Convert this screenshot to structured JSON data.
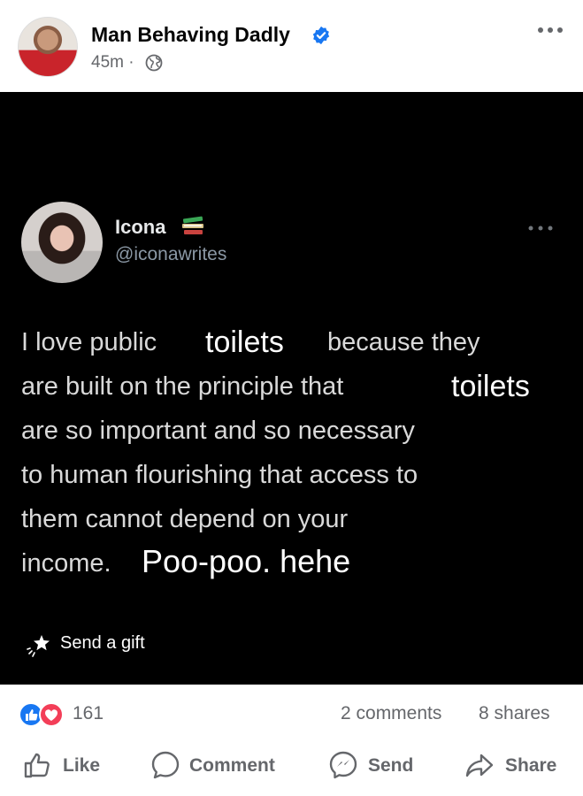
{
  "post": {
    "author": "Man Behaving Dadly",
    "time": "45m ·"
  },
  "tweet": {
    "name": "Icona",
    "handle": "@iconawrites",
    "lines": {
      "l1a": "I love public",
      "l1b": "because they",
      "l2": "are built on the principle that",
      "l3": "are so important and so necessary",
      "l4": "to human flourishing that access to",
      "l5": "them cannot depend on your",
      "l6": "income."
    },
    "overlays": {
      "o1": "toilets",
      "o2": "toilets",
      "o3": "Poo-poo. hehe"
    },
    "gift_label": "Send a gift"
  },
  "stats": {
    "reaction_count": "161",
    "comments": "2 comments",
    "shares": "8 shares"
  },
  "actions": {
    "like": "Like",
    "comment": "Comment",
    "send": "Send",
    "share": "Share"
  },
  "colors": {
    "facebook_blue": "#1877f2",
    "love_red": "#f33e58",
    "secondary_text": "#65676b",
    "tweet_background": "#000000"
  },
  "icons": [
    "verified-badge-icon",
    "globe-icon",
    "more-icon",
    "books-icon",
    "gift-icon",
    "like-reaction-icon",
    "love-reaction-icon",
    "like-icon",
    "comment-icon",
    "messenger-icon",
    "share-icon"
  ]
}
